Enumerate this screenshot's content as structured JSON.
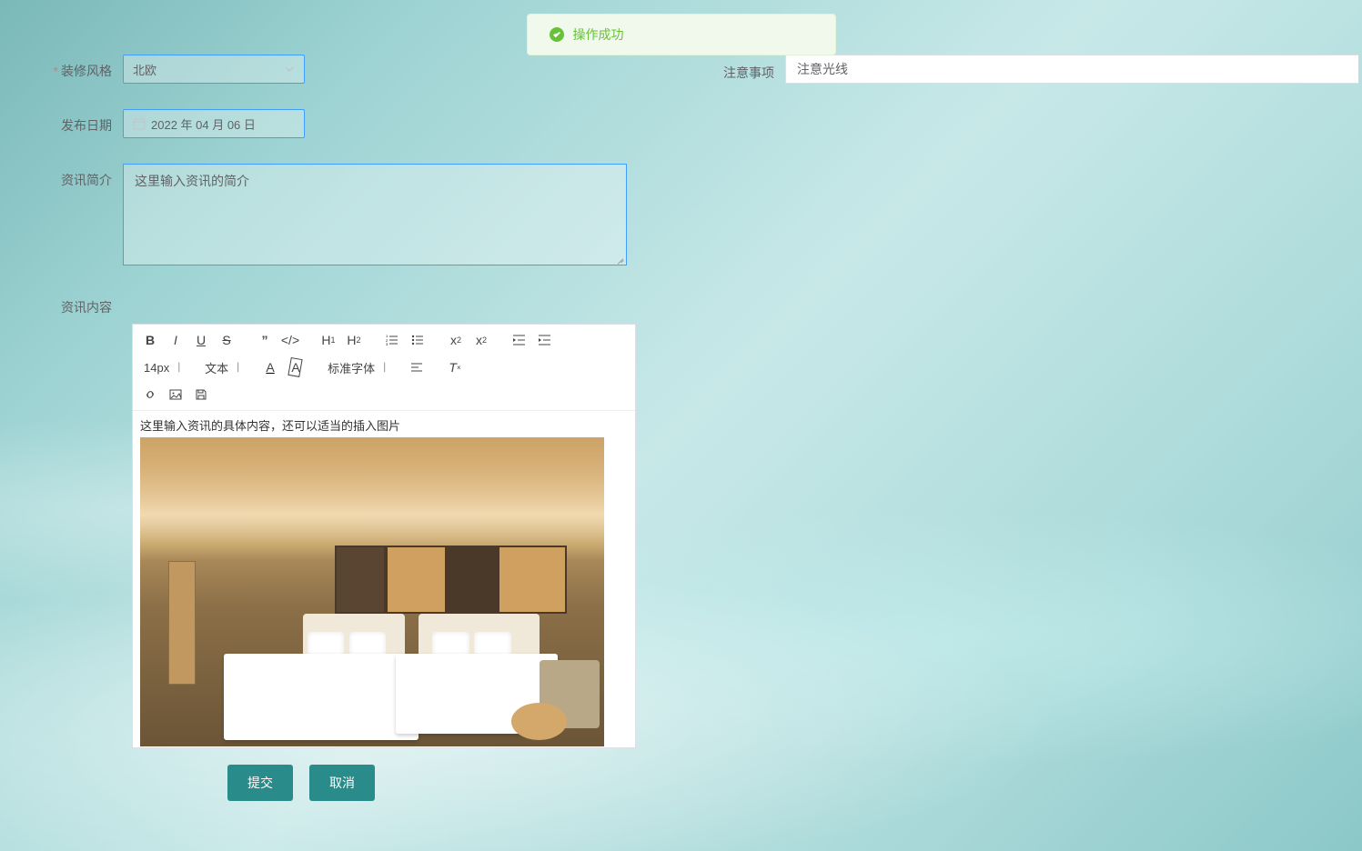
{
  "toast": {
    "message": "操作成功"
  },
  "form": {
    "style": {
      "label": "装修风格",
      "value": "北欧",
      "options": [
        "北欧"
      ]
    },
    "notes": {
      "label": "注意事项",
      "value": "注意光线"
    },
    "publish_date": {
      "label": "发布日期",
      "value": "2022 年 04 月 06 日"
    },
    "summary": {
      "label": "资讯简介",
      "value": "这里输入资讯的简介"
    },
    "content": {
      "label": "资讯内容"
    }
  },
  "editor": {
    "font_size": "14px",
    "paragraph": "文本",
    "font_family": "标准字体",
    "body_text": "这里输入资讯的具体内容，还可以适当的插入图片"
  },
  "buttons": {
    "submit": "提交",
    "cancel": "取消"
  }
}
